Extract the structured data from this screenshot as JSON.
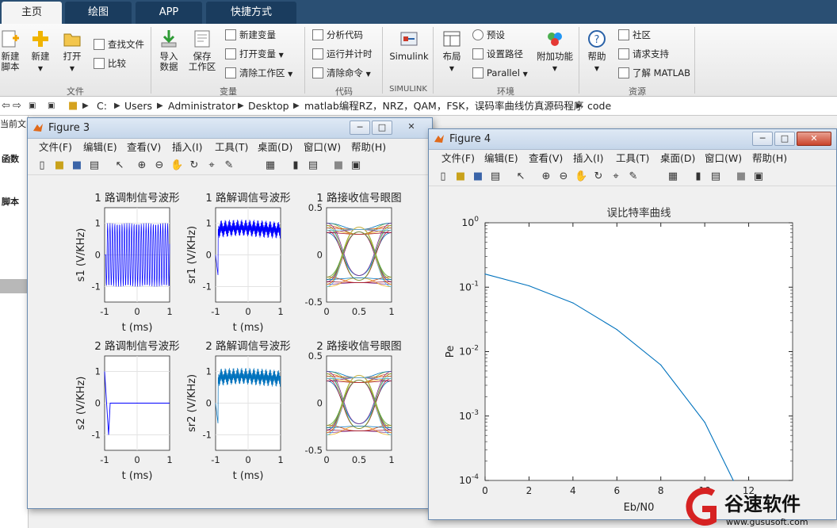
{
  "ribbon": {
    "tabs": [
      "主页",
      "绘图",
      "APP",
      "快捷方式"
    ],
    "file_group": {
      "new_script": "新建\n脚本",
      "new": "新建",
      "open": "打开",
      "find_files": "查找文件",
      "compare": "比较",
      "label": "文件"
    },
    "variable_group": {
      "import": "导入\n数据",
      "save_workspace": "保存\n工作区",
      "new_variable": "新建变量",
      "open_variable": "打开变量",
      "clear_workspace": "清除工作区",
      "label": "变量"
    },
    "code_group": {
      "analyze_code": "分析代码",
      "run_and_time": "运行并计时",
      "clear_commands": "清除命令",
      "label": "代码"
    },
    "simulink_group": {
      "simulink": "Simulink",
      "label": "SIMULINK"
    },
    "env_group": {
      "layout": "布局",
      "preferences": "预设",
      "set_path": "设置路径",
      "parallel": "Parallel",
      "addons": "附加功能",
      "label": "环境"
    },
    "resources_group": {
      "help": "帮助",
      "community": "社区",
      "request_support": "请求支持",
      "learn_matlab": "了解 MATLAB",
      "label": "资源"
    }
  },
  "address": {
    "crumbs": [
      "C:",
      "Users",
      "Administrator",
      "Desktop",
      "matlab编程RZ，NRZ，QAM，FSK，误码率曲线仿真源码程序",
      "code"
    ]
  },
  "left_panel": {
    "label_current": "当前文",
    "label_func": "函数",
    "label_script": "脚本"
  },
  "figure3": {
    "title": "Figure 3",
    "menus": [
      "文件(F)",
      "编辑(E)",
      "查看(V)",
      "插入(I)",
      "工具(T)",
      "桌面(D)",
      "窗口(W)",
      "帮助(H)"
    ],
    "subplots": {
      "s1": {
        "title": "1 路调制信号波形",
        "ylabel": "s1  (V/KHz)",
        "xlabel": "t (ms)"
      },
      "sr1": {
        "title": "1 路解调信号波形",
        "ylabel": "sr1  (V/KHz)",
        "xlabel": "t (ms)"
      },
      "eye1": {
        "title": "1 路接收信号眼图"
      },
      "s2": {
        "title": "2 路调制信号波形",
        "ylabel": "s2  (V/KHz)",
        "xlabel": "t (ms)"
      },
      "sr2": {
        "title": "2 路解调信号波形",
        "ylabel": "sr2  (V/KHz)",
        "xlabel": "t (ms)"
      },
      "eye2": {
        "title": "2 路接收信号眼图"
      }
    },
    "xticks": [
      "-1",
      "0",
      "1"
    ],
    "yticks": [
      "1",
      "0",
      "-1"
    ],
    "eye_xticks": [
      "0",
      "0.5",
      "1"
    ],
    "eye_yticks": [
      "0.5",
      "0",
      "-0.5"
    ]
  },
  "figure4": {
    "title": "Figure 4",
    "menus": [
      "文件(F)",
      "编辑(E)",
      "查看(V)",
      "插入(I)",
      "工具(T)",
      "桌面(D)",
      "窗口(W)",
      "帮助(H)"
    ]
  },
  "chart_data": [
    {
      "type": "line",
      "title": "误比特率曲线",
      "xlabel": "Eb/N0",
      "ylabel": "Pe",
      "yscale": "log",
      "xlim": [
        0,
        14
      ],
      "ylim": [
        0.0001,
        1
      ],
      "xticks": [
        "0",
        "2",
        "4",
        "6",
        "8",
        "10",
        "12"
      ],
      "ytick_labels": [
        "10^0",
        "10^-1",
        "10^-2",
        "10^-3",
        "10^-4"
      ],
      "x": [
        0,
        2,
        4,
        6,
        8,
        10,
        11.3
      ],
      "y": [
        0.16,
        0.105,
        0.057,
        0.022,
        0.0062,
        0.0008,
        0.0001
      ],
      "color": "#0072bd",
      "grid": false
    }
  ],
  "watermark": {
    "text": "谷速软件",
    "url": "www.gususoft.com"
  }
}
